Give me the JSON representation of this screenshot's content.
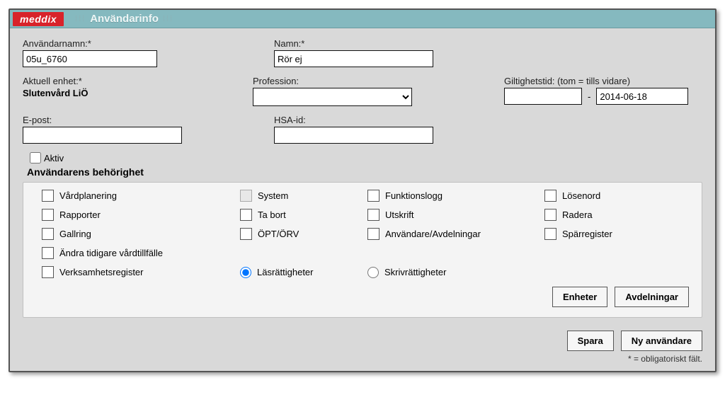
{
  "header": {
    "logo": "meddix",
    "title": "Användarinfo"
  },
  "fields": {
    "username_label": "Användarnamn:*",
    "username_value": "05u_6760",
    "name_label": "Namn:*",
    "name_value": "Rör ej",
    "unit_label": "Aktuell enhet:*",
    "unit_value": "Slutenvård LiÖ",
    "profession_label": "Profession:",
    "profession_value": "",
    "validity_label": "Giltighetstid: (tom = tills vidare)",
    "validity_from": "",
    "validity_to": "2014-06-18",
    "email_label": "E-post:",
    "email_value": "",
    "hsa_label": "HSA-id:",
    "hsa_value": "",
    "active_label": "Aktiv"
  },
  "permissions_title": "Användarens behörighet",
  "permissions": {
    "vardplanering": "Vårdplanering",
    "system": "System",
    "funktionslogg": "Funktionslogg",
    "losenord": "Lösenord",
    "rapporter": "Rapporter",
    "tabort": "Ta bort",
    "utskrift": "Utskrift",
    "radera": "Radera",
    "gallring": "Gallring",
    "optorv": "ÖPT/ÖRV",
    "anvavd": "Användare/Avdelningar",
    "sparr": "Spärregister",
    "andra": "Ändra tidigare vårdtillfälle",
    "verksamhet": "Verksamhetsregister",
    "las": "Läsrättigheter",
    "skriv": "Skrivrättigheter"
  },
  "buttons": {
    "enheter": "Enheter",
    "avdelningar": "Avdelningar",
    "spara": "Spara",
    "nyanv": "Ny användare"
  },
  "footer_note": "* = obligatoriskt fält."
}
